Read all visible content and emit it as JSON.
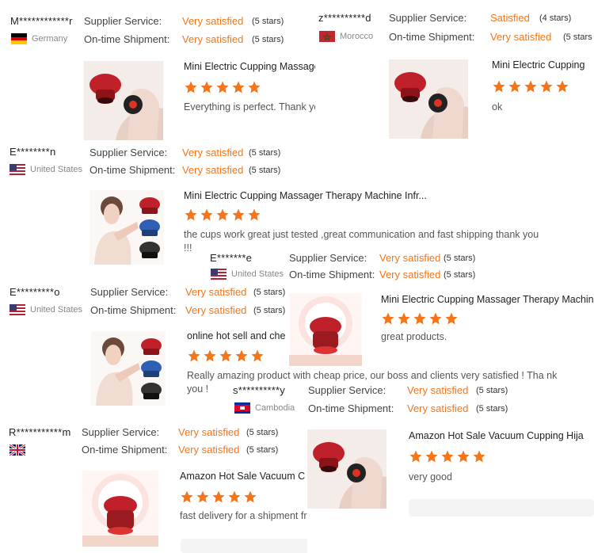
{
  "labels": {
    "supplier_service": "Supplier Service:",
    "ontime_shipment": "On-time Shipment:"
  },
  "reviews": [
    {
      "user": "M************r",
      "country": "Germany",
      "supplier_rating": "Very satisfied",
      "supplier_stars": "(5 stars)",
      "shipment_rating": "Very satisfied",
      "shipment_stars": "(5 stars)",
      "product_title": "Mini Electric Cupping Massager Therapy Ma",
      "review_text": "Everything is perfect. Thank you very much!"
    },
    {
      "user": "z**********d",
      "country": "Morocco",
      "supplier_rating": "Satisfied",
      "supplier_stars": "(4 stars)",
      "shipment_rating": "Very satisfied",
      "shipment_stars": "(5 stars",
      "product_title": "Mini Electric Cupping",
      "review_text": "ok"
    },
    {
      "user": "E********n",
      "country": "United States",
      "supplier_rating": "Very satisfied",
      "supplier_stars": "(5 stars)",
      "shipment_rating": "Very satisfied",
      "shipment_stars": "(5 stars)",
      "product_title": "Mini Electric Cupping Massager Therapy Machine Infr...",
      "review_text": "the cups work great just tested ,great communication and fast shipping thank you !!!"
    },
    {
      "user": "E*******e",
      "country": "United States",
      "supplier_rating": "Very satisfied",
      "supplier_stars": "(5 stars)",
      "shipment_rating": "Very satisfied",
      "shipment_stars": "(5 stars)",
      "product_title": "Mini Electric Cupping Massager Therapy Machine",
      "review_text": "great products."
    },
    {
      "user": "E*********o",
      "country": "United States",
      "supplier_rating": "Very satisfied",
      "supplier_stars": "(5 stars)",
      "shipment_rating": "Very satisfied",
      "shipment_stars": "(5 stars)",
      "product_title": "online hot sell and che",
      "review_text": "Really amazing product with cheap price, our boss and clients very satisfied ! Tha nk you !"
    },
    {
      "user": "s**********y",
      "country": "Cambodia",
      "supplier_rating": "Very satisfied",
      "supplier_stars": "(5 stars)",
      "shipment_rating": "Very satisfied",
      "shipment_stars": "(5 stars)",
      "product_title": "",
      "review_text": ""
    },
    {
      "user": "R***********m",
      "country": "",
      "supplier_rating": "Very satisfied",
      "supplier_stars": "(5 stars)",
      "shipment_rating": "Very satisfied",
      "shipment_stars": "(5 stars)",
      "product_title": "Amazon Hot Sale Vacuum C",
      "review_text": "fast delivery for a shipment from China, friendly custome service"
    },
    {
      "user": "",
      "country": "",
      "supplier_rating": "",
      "supplier_stars": "",
      "shipment_rating": "",
      "shipment_stars": "",
      "product_title": "Amazon Hot Sale Vacuum Cupping Hija",
      "review_text": "very good"
    }
  ],
  "colors": {
    "accent": "#f5751b",
    "star": "#f5751b"
  },
  "icons": {
    "star": "star-icon"
  }
}
